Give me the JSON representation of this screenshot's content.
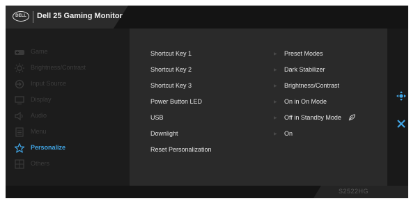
{
  "header": {
    "logo_text": "DELL",
    "title": "Dell 25 Gaming Monitor"
  },
  "colors": {
    "accent": "#41a6e6",
    "inactive_text": "#3c3c3c",
    "text": "#e4e4e4"
  },
  "sidebar": {
    "items": [
      {
        "label": "Game",
        "icon": "gamepad-icon",
        "active": false
      },
      {
        "label": "Brightness/Contrast",
        "icon": "brightness-icon",
        "active": false
      },
      {
        "label": "Input Source",
        "icon": "input-source-icon",
        "active": false
      },
      {
        "label": "Display",
        "icon": "display-icon",
        "active": false
      },
      {
        "label": "Audio",
        "icon": "speaker-icon",
        "active": false
      },
      {
        "label": "Menu",
        "icon": "menu-icon",
        "active": false
      },
      {
        "label": "Personalize",
        "icon": "star-icon",
        "active": true
      },
      {
        "label": "Others",
        "icon": "others-icon",
        "active": false
      }
    ]
  },
  "options": [
    {
      "label": "Shortcut Key 1",
      "value": "Preset Modes"
    },
    {
      "label": "Shortcut Key 2",
      "value": "Dark Stabilizer"
    },
    {
      "label": "Shortcut Key 3",
      "value": "Brightness/Contrast"
    },
    {
      "label": "Power Button LED",
      "value": "On in On Mode"
    },
    {
      "label": "USB",
      "value": "Off in Standby Mode"
    },
    {
      "label": "Downlight",
      "value": "On"
    },
    {
      "label": "Reset Personalization",
      "value": ""
    }
  ],
  "controls": {
    "navigate": "joystick-icon",
    "exit": "close-icon"
  },
  "footer": {
    "model": "S2522HG"
  }
}
